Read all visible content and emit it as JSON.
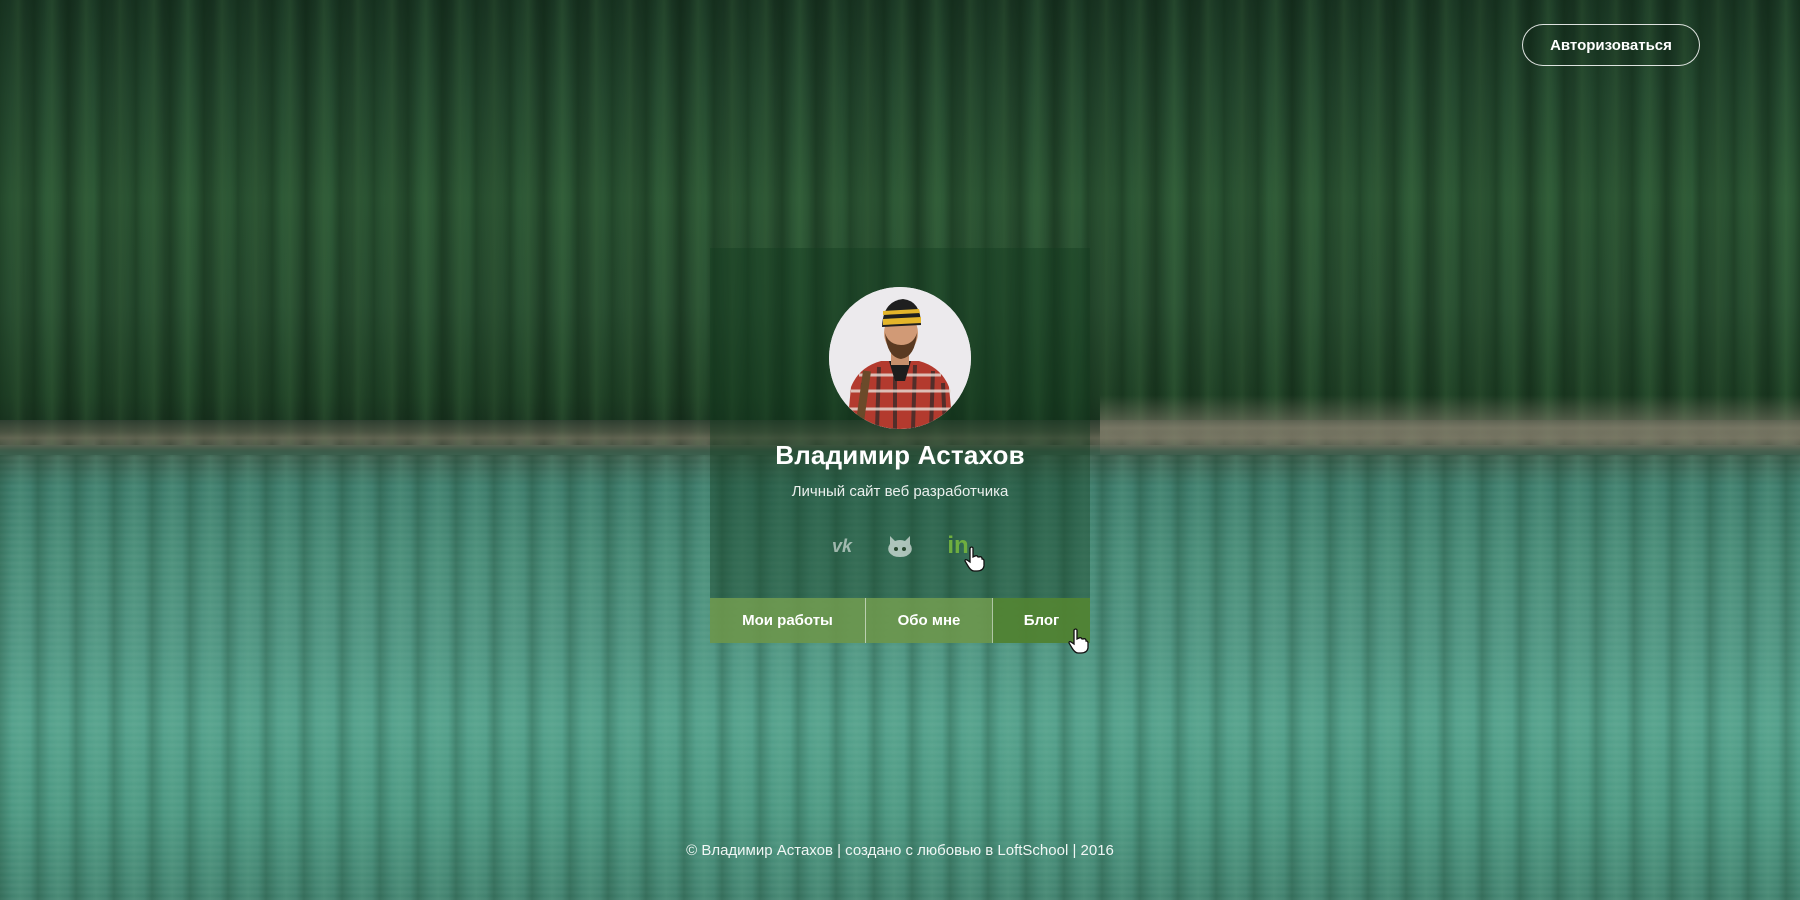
{
  "header": {
    "auth_label": "Авторизоваться"
  },
  "profile": {
    "name": "Владимир Астахов",
    "subtitle": "Личный сайт веб разработчика",
    "avatar_icon": "user-photo"
  },
  "socials": [
    {
      "name": "vk",
      "icon": "vk-icon",
      "label": "vk"
    },
    {
      "name": "github",
      "icon": "github-icon"
    },
    {
      "name": "linkedin",
      "icon": "linkedin-icon",
      "label": "in"
    }
  ],
  "nav": {
    "items": [
      {
        "label": "Мои работы"
      },
      {
        "label": "Обо мне"
      },
      {
        "label": "Блог"
      }
    ]
  },
  "footer": {
    "text": "© Владимир Астахов | создано с любовью в LoftSchool | 2016"
  },
  "colors": {
    "accent": "#6c964b",
    "linkedin": "#6fae3f"
  }
}
